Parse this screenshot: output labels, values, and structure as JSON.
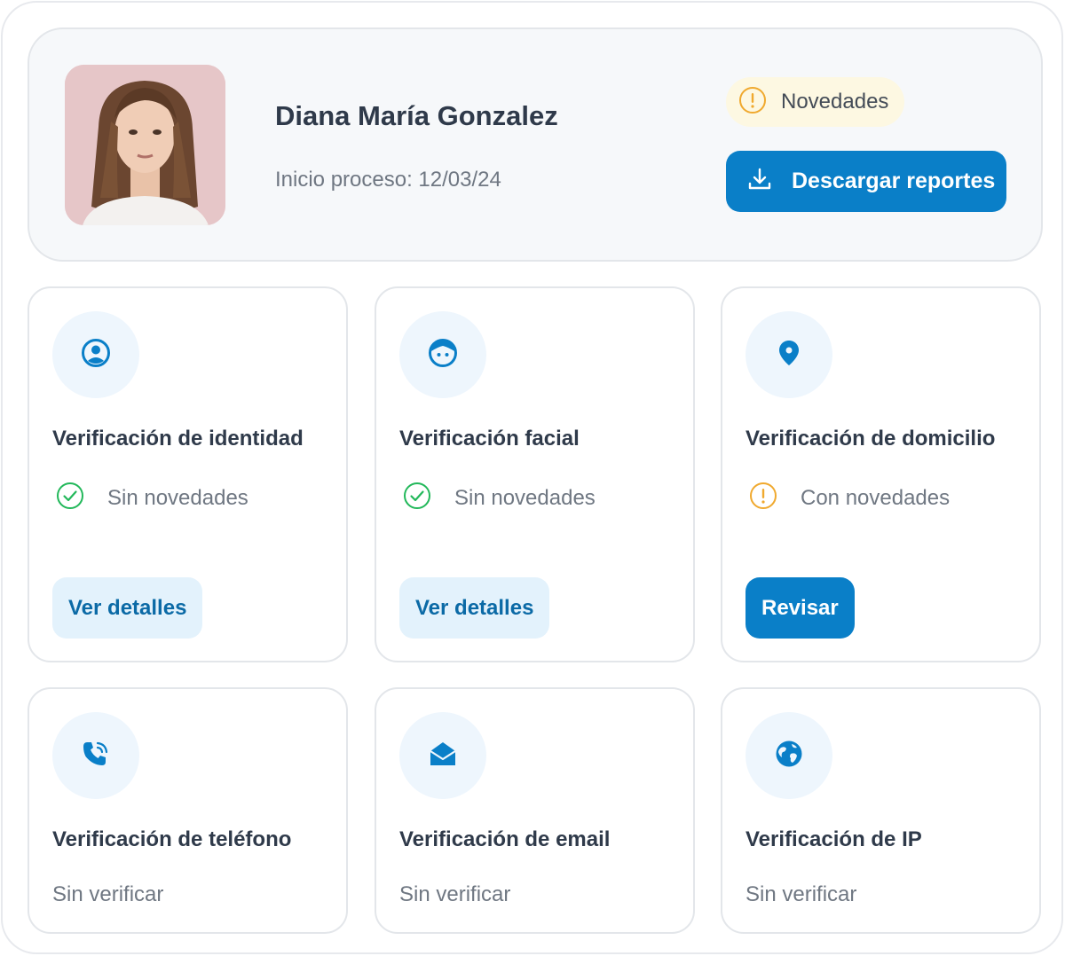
{
  "profile": {
    "name": "Diana María Gonzalez",
    "start_label": "Inicio proceso: 12/03/24"
  },
  "header": {
    "badge_label": "Novedades",
    "download_label": "Descargar reportes"
  },
  "colors": {
    "primary": "#0a7fc8",
    "success": "#22b85a",
    "warning": "#f0a92e",
    "icon_bg": "#eef6fd"
  },
  "cards": [
    {
      "title": "Verificación de identidad",
      "icon": "user-circle-icon",
      "status_icon": "check-circle-icon",
      "status": "Sin novedades",
      "action": "Ver detalles"
    },
    {
      "title": "Verificación facial",
      "icon": "face-icon",
      "status_icon": "check-circle-icon",
      "status": "Sin novedades",
      "action": "Ver detalles"
    },
    {
      "title": "Verificación de domicilio",
      "icon": "location-pin-icon",
      "status_icon": "warning-circle-icon",
      "status": "Con novedades",
      "action": "Revisar"
    },
    {
      "title": "Verificación de teléfono",
      "icon": "phone-icon",
      "status": "Sin verificar"
    },
    {
      "title": "Verificación de email",
      "icon": "envelope-icon",
      "status": "Sin verificar"
    },
    {
      "title": "Verificación de IP",
      "icon": "globe-icon",
      "status": "Sin verificar"
    }
  ]
}
